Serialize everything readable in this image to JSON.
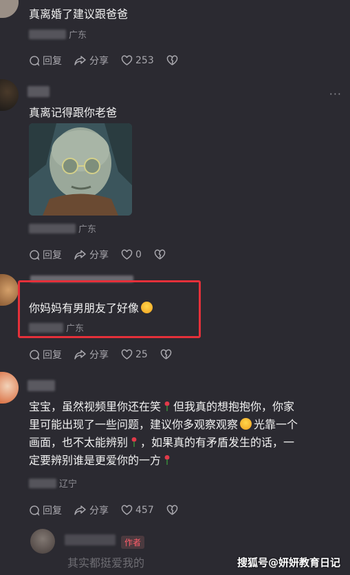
{
  "comments": [
    {
      "text": "真离婚了建议跟爸爸",
      "location": "广东",
      "reply_label": "回复",
      "share_label": "分享",
      "likes": "253"
    },
    {
      "text": "真离记得跟你老爸",
      "location": "广东",
      "reply_label": "回复",
      "share_label": "分享",
      "likes": "0"
    },
    {
      "text": "你妈妈有男朋友了好像",
      "location": "广东",
      "reply_label": "回复",
      "share_label": "分享",
      "likes": "25"
    },
    {
      "text_line1_a": "宝宝，虽然视频里你还在笑",
      "text_line1_b": "但我真的想抱抱你，你家",
      "text_line2": "里可能出现了一些问题，建议你多观察观察",
      "text_line2_b": "光靠一个",
      "text_line3_a": "画面，也不太能辨别",
      "text_line3_b": "，如果真的有矛盾发生的话，一",
      "text_line4": "定要辨别谁是更爱你的一方",
      "location": "辽宁",
      "reply_label": "回复",
      "share_label": "分享",
      "likes": "457"
    }
  ],
  "reply_preview": {
    "author_tag": "作者",
    "text": "其实都挺爱我的"
  },
  "watermark": "搜狐号@妍妍教育日记",
  "colors": {
    "background": "#2b2a31",
    "highlight_border": "#e5303a",
    "author_tag": "#ff5d6a"
  }
}
